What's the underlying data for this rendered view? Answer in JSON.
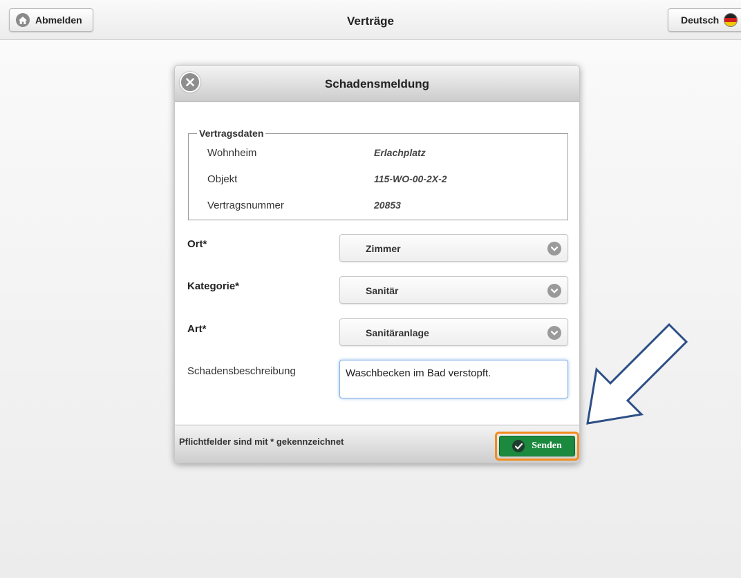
{
  "header": {
    "logout_label": "Abmelden",
    "title": "Verträge",
    "language_label": "Deutsch"
  },
  "dialog": {
    "title": "Schadensmeldung",
    "contract": {
      "legend": "Vertragsdaten",
      "rows": [
        {
          "label": "Wohnheim",
          "value": "Erlachplatz"
        },
        {
          "label": "Objekt",
          "value": "115-WO-00-2X-2"
        },
        {
          "label": "Vertragsnummer",
          "value": "20853"
        }
      ]
    },
    "fields": {
      "ort": {
        "label": "Ort*",
        "value": "Zimmer"
      },
      "kategorie": {
        "label": "Kategorie*",
        "value": "Sanitär"
      },
      "art": {
        "label": "Art*",
        "value": "Sanitäranlage"
      },
      "beschreibung": {
        "label": "Schadensbeschreibung",
        "value": "Waschbecken im Bad verstopft."
      }
    },
    "footer": {
      "note": "Pflichtfelder sind mit * gekennzeichnet",
      "send_label": "Senden"
    }
  },
  "colors": {
    "send_button": "#1b8a3e",
    "highlight_outline": "#f28c1e",
    "annotation_arrow": "#2c4f86"
  },
  "icons": [
    "home-icon",
    "german-flag-icon",
    "close-icon",
    "chevron-down-icon",
    "checkmark-icon",
    "arrow-annotation-icon"
  ]
}
